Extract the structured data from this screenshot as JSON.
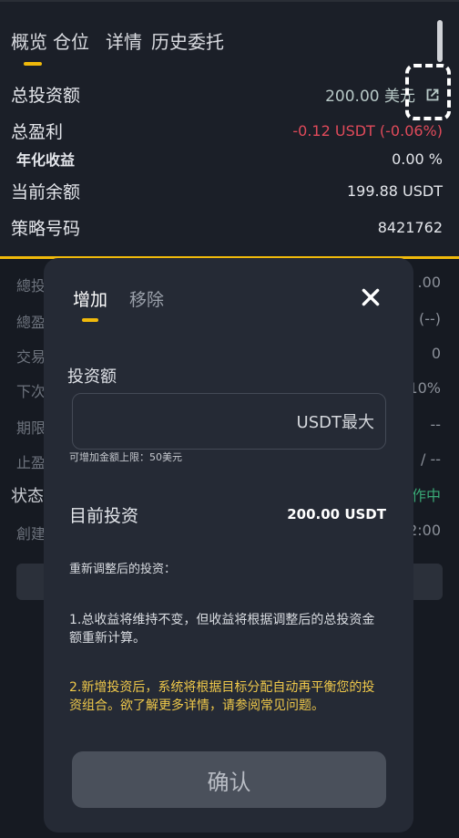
{
  "tabs": {
    "overview": "概览",
    "positions": "仓位",
    "details": "详情",
    "history": "历史委托"
  },
  "summary": {
    "total_investment_label": "总投资额",
    "total_investment_value": "200.00 美元",
    "total_pnl_label": "总盈利",
    "total_pnl_value": "-0.12  USDT  (-0.06%)",
    "annual_label": "年化收益",
    "annual_value": "0.00  %",
    "balance_label": "当前余额",
    "balance_value": "199.88  USDT",
    "strategy_label": "策略号码",
    "strategy_value": "8421762"
  },
  "background": {
    "item1": "總投",
    "item2": "總盈",
    "item3": "交易",
    "item4": "下次",
    "item5": "期限",
    "item6": "止盈",
    "status_label": "状态",
    "item8": "創建",
    "val1": ".00",
    "val2": "(--)",
    "val3": "0",
    "val4": "10%",
    "val5": "--",
    "val6": "/ --",
    "val7": "作中",
    "val8": "2:00"
  },
  "modal": {
    "tab_add": "增加",
    "tab_remove": "移除",
    "investment_label": "投资额",
    "input_value": "",
    "input_unit": "USDT最大",
    "hint": "可增加金额上限：50美元",
    "current_label": "目前投资",
    "current_value": "200.00 USDT",
    "note_title": "重新调整后的投资：",
    "note1": "1.总收益将维持不变，但收益将根据调整后的总投资金额重新计算。",
    "note2": "2.新增投资后，系统将根据目标分配自动再平衡您的投资组合。欲了解更多详情，请参阅常见问题。",
    "confirm": "确认"
  },
  "icons": {
    "external": "external-link-icon",
    "close": "close-icon"
  },
  "colors": {
    "accent": "#f0b90b",
    "negative": "#e04a5a",
    "note_highlight": "#f0c94a"
  }
}
